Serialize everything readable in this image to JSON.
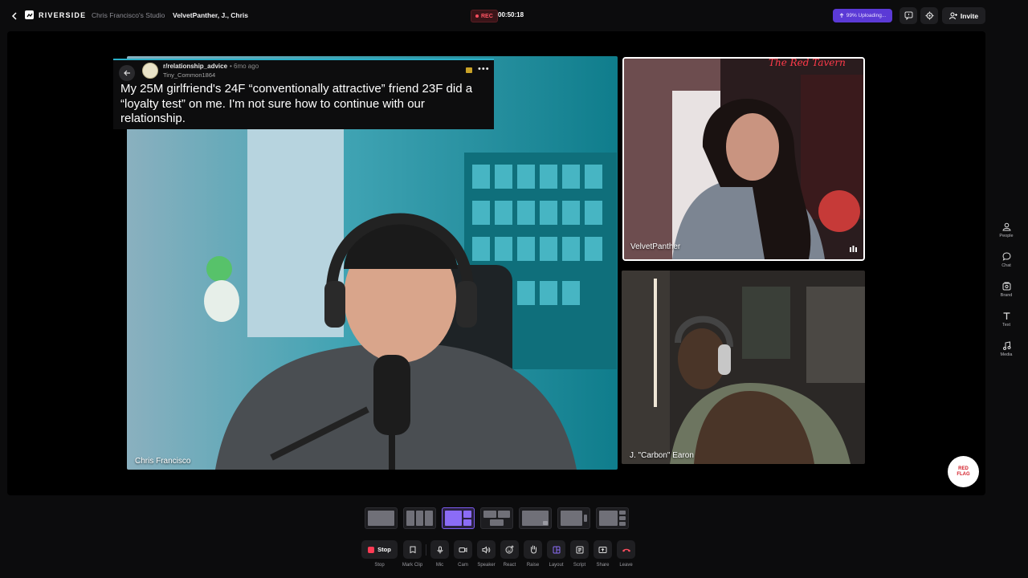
{
  "header": {
    "logo_text": "RIVERSIDE",
    "studio_name": "Chris Francisco's Studio",
    "session_name": "VelvetPanther, J., Chris",
    "rec_label": "REC",
    "timer": "00:50:18",
    "upload_status": "99% Uploading...",
    "invite_label": "Invite"
  },
  "reddit_post": {
    "subreddit": "r/relationship_advice",
    "time_ago": "• 6mo ago",
    "username": "Tiny_Common1864",
    "title": "My 25M girlfriend's 24F “conventionally attractive” friend 23F did a “loyalty test” on me. I'm not sure how to continue with our relationship."
  },
  "participants": {
    "main": "Chris Francisco",
    "top_right": "VelvetPanther",
    "bottom_right": "J. \"Carbon\" Earon"
  },
  "right_rail": [
    {
      "label": "People",
      "icon": "people-icon"
    },
    {
      "label": "Chat",
      "icon": "chat-icon"
    },
    {
      "label": "Brand",
      "icon": "brand-icon"
    },
    {
      "label": "Text",
      "icon": "text-icon"
    },
    {
      "label": "Media",
      "icon": "media-icon"
    }
  ],
  "brand_badge": {
    "line1": "RED",
    "line2": "FLAG"
  },
  "layouts": {
    "selected_index": 2,
    "count": 7
  },
  "controls": [
    {
      "label": "Stop",
      "button_text": "Stop",
      "icon": "stop-icon"
    },
    {
      "label": "Mark Clip",
      "icon": "bookmark-icon"
    },
    {
      "label": "Mic",
      "icon": "mic-icon"
    },
    {
      "label": "Cam",
      "icon": "camera-icon"
    },
    {
      "label": "Speaker",
      "icon": "speaker-icon"
    },
    {
      "label": "React",
      "icon": "react-icon"
    },
    {
      "label": "Raise",
      "icon": "hand-icon"
    },
    {
      "label": "Layout",
      "icon": "layout-icon"
    },
    {
      "label": "Script",
      "icon": "script-icon"
    },
    {
      "label": "Share",
      "icon": "share-icon"
    },
    {
      "label": "Leave",
      "icon": "leave-icon"
    }
  ],
  "colors": {
    "accent": "#7b5cf0",
    "rec": "#ff4d5e",
    "upload": "#5b3ad6",
    "leave": "#ff4d5e",
    "teal_glow": "#2ab0c8"
  }
}
